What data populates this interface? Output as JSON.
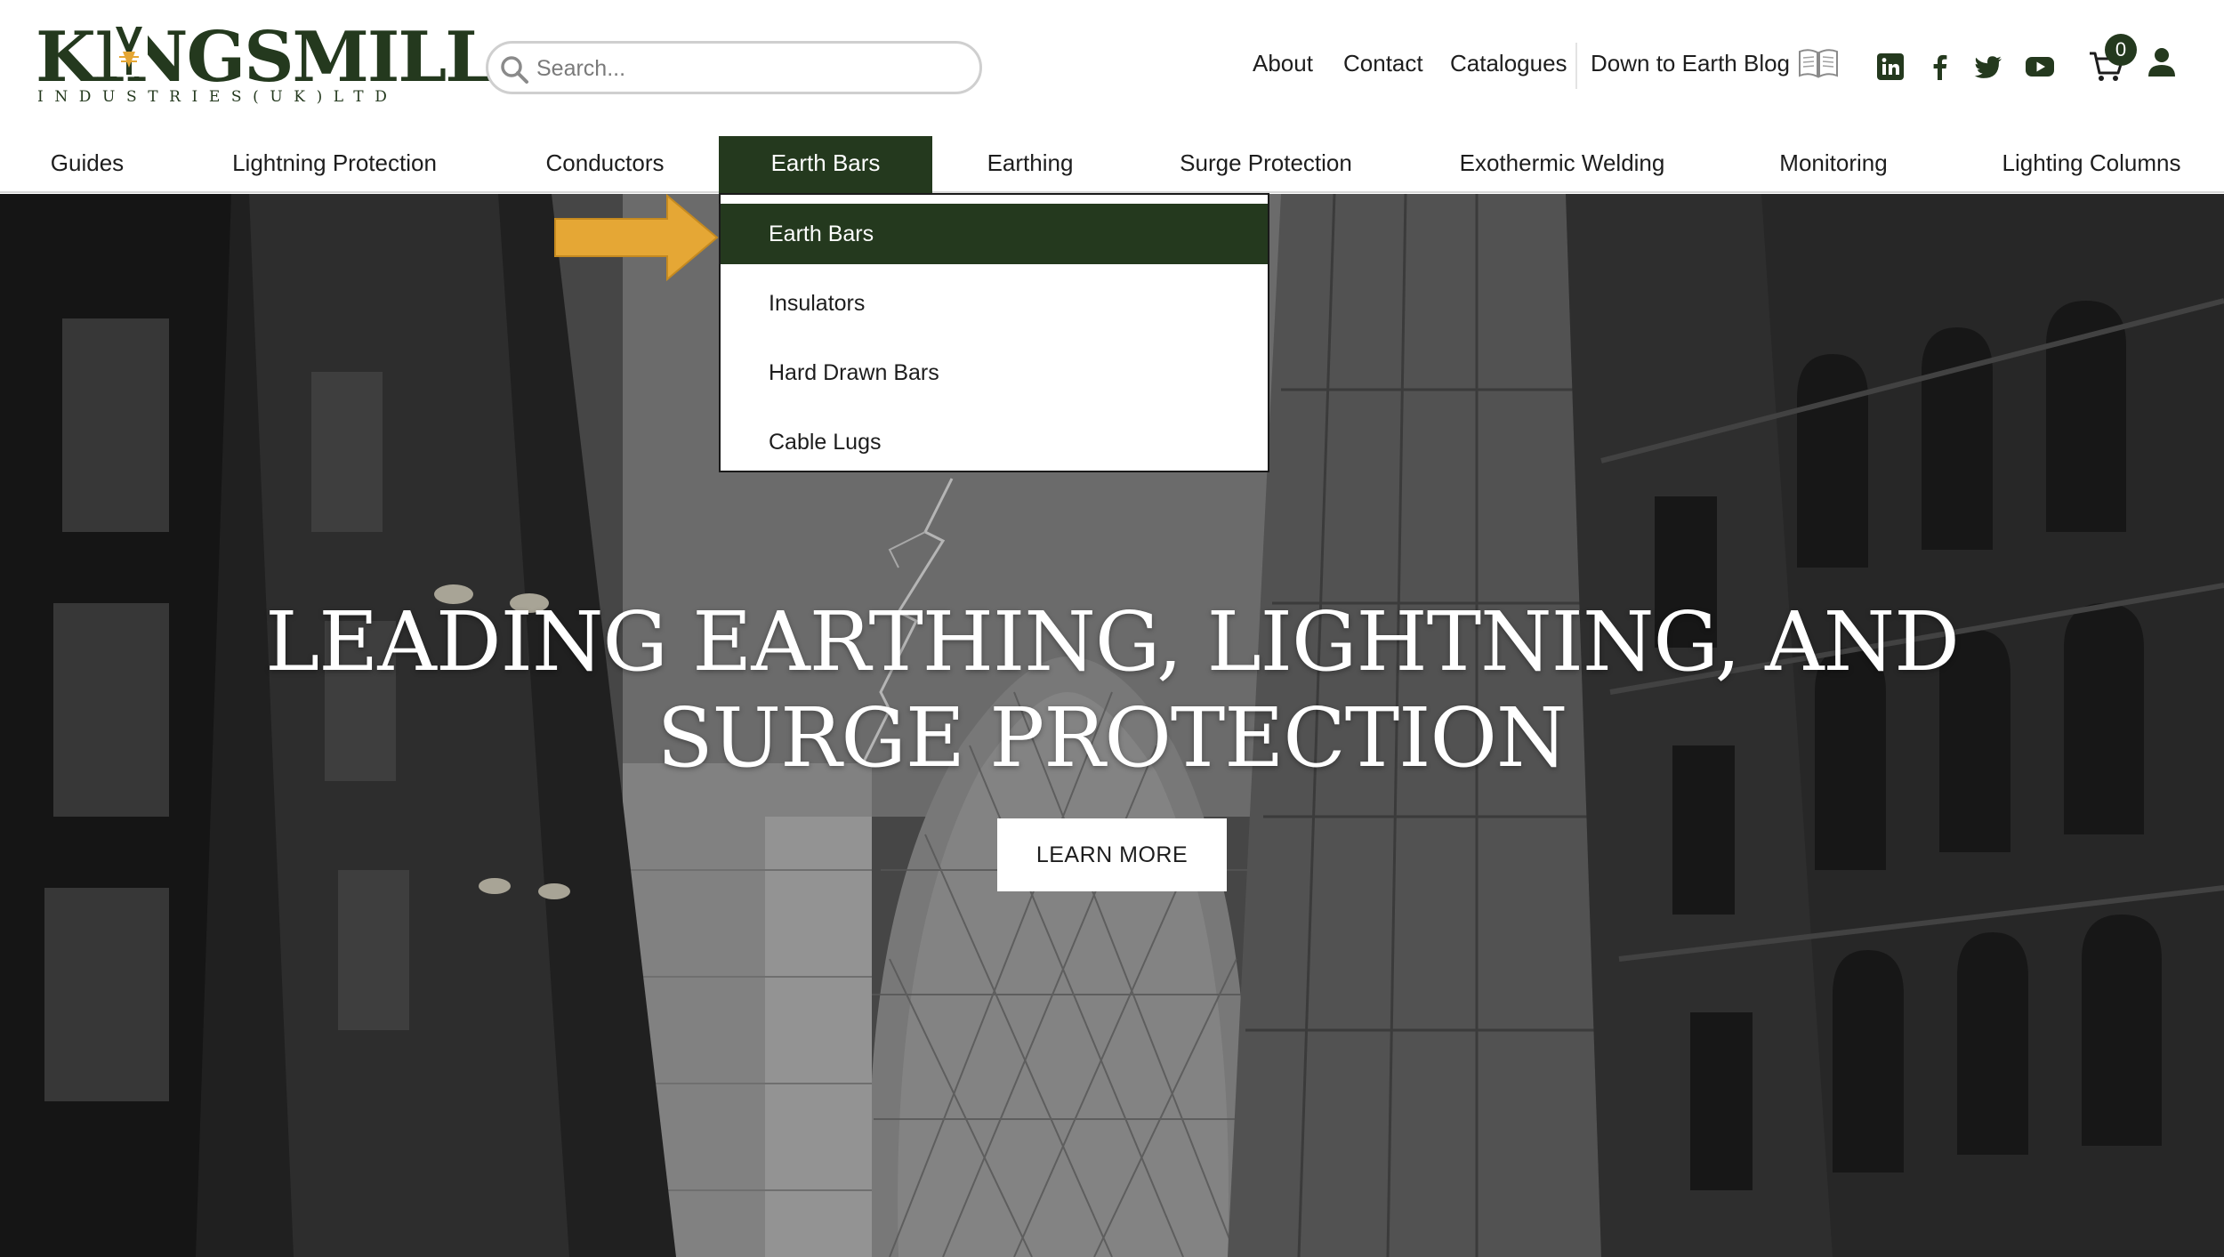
{
  "brand": {
    "logo_main": "KINGSMILL",
    "logo_sub": "INDUSTRIES(UK)LTD"
  },
  "search": {
    "placeholder": "Search..."
  },
  "top_links": {
    "about": "About",
    "contact": "Contact",
    "catalogues": "Catalogues",
    "blog": "Down to Earth Blog"
  },
  "icons": {
    "search": "search-icon",
    "blog": "book-icon",
    "linkedin": "linkedin-icon",
    "facebook": "facebook-icon",
    "twitter": "twitter-icon",
    "youtube": "youtube-icon",
    "cart": "cart-icon",
    "user": "user-icon"
  },
  "cart": {
    "count": "0"
  },
  "nav": {
    "items": [
      {
        "label": "Guides"
      },
      {
        "label": "Lightning Protection"
      },
      {
        "label": "Conductors"
      },
      {
        "label": "Earth Bars",
        "active": true
      },
      {
        "label": "Earthing"
      },
      {
        "label": "Surge Protection"
      },
      {
        "label": "Exothermic Welding"
      },
      {
        "label": "Monitoring"
      },
      {
        "label": "Lighting Columns"
      }
    ]
  },
  "dropdown": {
    "items": [
      {
        "label": "Earth Bars",
        "active": true
      },
      {
        "label": "Insulators"
      },
      {
        "label": "Hard Drawn Bars"
      },
      {
        "label": "Cable Lugs"
      }
    ]
  },
  "hero": {
    "title_line1": "LEADING EARTHING, LIGHTNING, AND",
    "title_line2": "SURGE PROTECTION",
    "button_label": "LEARN MORE"
  },
  "colors": {
    "brand_green": "#24391e",
    "callout_arrow": "#e5a735",
    "white": "#ffffff"
  }
}
